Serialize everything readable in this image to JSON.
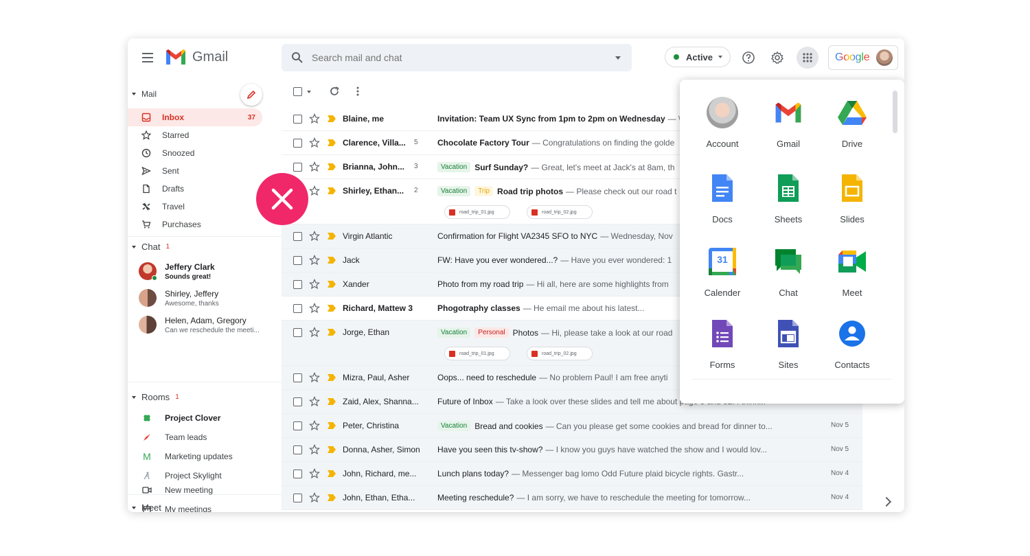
{
  "header": {
    "app_name": "Gmail",
    "search_placeholder": "Search mail and chat",
    "status_label": "Active",
    "google_word": "Google"
  },
  "sidebar": {
    "mail_section": "Mail",
    "nav_items": [
      {
        "label": "Inbox",
        "count": "37",
        "icon": "inbox-icon"
      },
      {
        "label": "Starred",
        "icon": "star-icon"
      },
      {
        "label": "Snoozed",
        "icon": "clock-icon"
      },
      {
        "label": "Sent",
        "icon": "send-icon"
      },
      {
        "label": "Drafts",
        "icon": "draft-icon"
      },
      {
        "label": "Travel",
        "icon": "plane-icon"
      },
      {
        "label": "Purchases",
        "icon": "cart-icon"
      }
    ],
    "chat_section": "Chat",
    "chat_badge": "1",
    "chats": [
      {
        "name": "Jeffery Clark",
        "sub": "Sounds great!"
      },
      {
        "name": "Shirley, Jeffery",
        "sub": "Awesome, thanks"
      },
      {
        "name": "Helen, Adam, Gregory",
        "sub": "Can we reschedule the meeti..."
      }
    ],
    "rooms_section": "Rooms",
    "rooms_badge": "1",
    "rooms": [
      {
        "label": "Project Clover"
      },
      {
        "label": "Team leads"
      },
      {
        "label": "Marketing updates",
        "letter": "M"
      },
      {
        "label": "Project Skylight"
      }
    ],
    "meet_section": "Meet",
    "meet_items": [
      {
        "label": "New meeting"
      },
      {
        "label": "My meetings"
      }
    ]
  },
  "mails": [
    {
      "sender": "Blaine, me",
      "thread": "",
      "labels": [],
      "subject": "Invitation: Team UX Sync from 1pm to 2pm on Wednesday",
      "snippet": "— \\",
      "date": "",
      "unread": true
    },
    {
      "sender": "Clarence, Villa...",
      "thread": "5",
      "labels": [],
      "subject": "Chocolate Factory Tour",
      "snippet": "— Congratulations on finding the golde",
      "date": "",
      "unread": true
    },
    {
      "sender": "Brianna, John...",
      "thread": "3",
      "labels": [
        "Vacation"
      ],
      "subject": "Surf Sunday?",
      "snippet": "— Great, let's meet at Jack's at 8am, th",
      "date": "",
      "unread": true
    },
    {
      "sender": "Shirley, Ethan...",
      "thread": "2",
      "labels": [
        "Vacation",
        "Trip"
      ],
      "subject": "Road trip photos",
      "snippet": "— Please check out our road t",
      "date": "",
      "unread": true,
      "attachments": [
        "road_trip_01.jpg",
        "road_trip_02.jpg"
      ]
    },
    {
      "sender": "Virgin Atlantic",
      "thread": "",
      "labels": [],
      "subject": "Confirmation for Flight VA2345 SFO to NYC",
      "snippet": "— Wednesday, Nov",
      "date": "",
      "unread": false
    },
    {
      "sender": "Jack",
      "thread": "",
      "labels": [],
      "subject": "FW: Have you ever wondered...?",
      "snippet": "— Have you ever wondered: 1",
      "date": "",
      "unread": false
    },
    {
      "sender": "Xander",
      "thread": "",
      "labels": [],
      "subject": "Photo from my road trip",
      "snippet": "— Hi all, here are some highlights from",
      "date": "",
      "unread": false
    },
    {
      "sender": "Richard, Mattew 3",
      "thread": "",
      "labels": [],
      "subject": "Phogotraphy classes",
      "snippet": "— He email me about his latest...",
      "date": "",
      "unread": true
    },
    {
      "sender": "Jorge, Ethan",
      "thread": "",
      "labels": [
        "Vacation",
        "Personal"
      ],
      "subject": "Photos",
      "snippet": "— Hi, please take a look at our road",
      "date": "",
      "unread": false,
      "attachments": [
        "road_trip_01.jpg",
        "road_trip_02.jpg"
      ]
    },
    {
      "sender": "Mizra, Paul, Asher",
      "thread": "",
      "labels": [],
      "subject": "Oops... need to reschedule",
      "snippet": "— No problem Paul! I am free anyti",
      "date": "",
      "unread": false
    },
    {
      "sender": "Zaid, Alex, Shanna...",
      "thread": "",
      "labels": [],
      "subject": "Future of Inbox",
      "snippet": "— Take a look over these slides and tell me about page 5 and 32. I think...",
      "date": "Nov 5",
      "unread": false
    },
    {
      "sender": "Peter, Christina",
      "thread": "",
      "labels": [
        "Vacation"
      ],
      "subject": "Bread and cookies",
      "snippet": "— Can you please get some cookies and bread for dinner to...",
      "date": "Nov 5",
      "unread": false
    },
    {
      "sender": "Donna, Asher, Simon",
      "thread": "",
      "labels": [],
      "subject": "Have you seen this tv-show?",
      "snippet": "— I know you guys have watched the show and I would lov...",
      "date": "Nov 5",
      "unread": false
    },
    {
      "sender": "John, Richard, me...",
      "thread": "",
      "labels": [],
      "subject": "Lunch plans today?",
      "snippet": "— Messenger bag lomo Odd Future plaid bicycle rights. Gastr...",
      "date": "Nov 4",
      "unread": false
    },
    {
      "sender": "John, Ethan, Etha...",
      "thread": "",
      "labels": [],
      "subject": "Meeting reschedule?",
      "snippet": "— I am sorry, we have to reschedule the meeting for tomorrow...",
      "date": "Nov 4",
      "unread": false
    }
  ],
  "apps": [
    {
      "label": "Account"
    },
    {
      "label": "Gmail"
    },
    {
      "label": "Drive"
    },
    {
      "label": "Docs"
    },
    {
      "label": "Sheets"
    },
    {
      "label": "Slides"
    },
    {
      "label": "Calender",
      "day": "31"
    },
    {
      "label": "Chat"
    },
    {
      "label": "Meet"
    },
    {
      "label": "Forms"
    },
    {
      "label": "Sites"
    },
    {
      "label": "Contacts"
    }
  ],
  "colors": {
    "accent_red": "#d93025",
    "error_badge": "#f0286a",
    "vacation_chip": "#188038",
    "trip_chip": "#e8a400",
    "personal_chip": "#c5221f"
  }
}
